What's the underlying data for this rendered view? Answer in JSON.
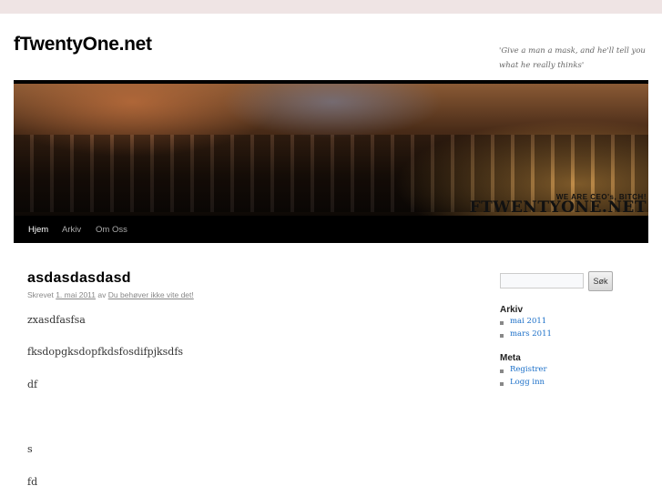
{
  "site": {
    "title": "fTwentyOne.net",
    "description": "'Give a man a mask, and he'll tell you what he really thinks'"
  },
  "banner": {
    "slogan": "WE ARE CEO's, BITCH!",
    "logo": "FTWENTYONE.NET"
  },
  "nav": [
    "Hjem",
    "Arkiv",
    "Om Oss"
  ],
  "post": {
    "title": "asdasdasdasd",
    "meta_prefix": "Skrevet",
    "date": "1. mai 2011",
    "meta_by": "av",
    "author": "Du behøver ikke vite det!",
    "paragraphs": [
      "zxasdfasfsa",
      "fksdopgksdopfkdsfosdifpjksdfs",
      "df",
      "s",
      "fd"
    ]
  },
  "sidebar": {
    "search_button": "Søk",
    "search_value": "",
    "archive_title": "Arkiv",
    "archive": [
      "mai 2011",
      "mars 2011"
    ],
    "meta_title": "Meta",
    "meta": [
      "Registrer",
      "Logg inn"
    ]
  },
  "colors": {
    "link": "#1b6fc8",
    "topbar": "#efe4e4",
    "nav": "#000000"
  }
}
